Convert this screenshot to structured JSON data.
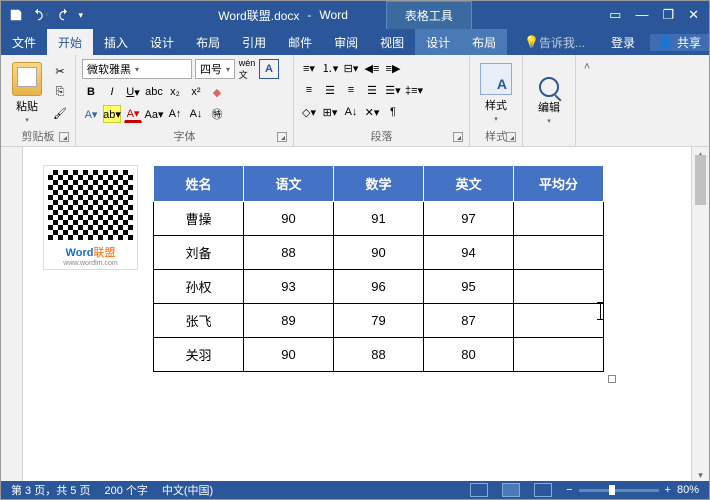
{
  "title": {
    "filename": "Word联盟.docx",
    "app": "Word",
    "tableTools": "表格工具"
  },
  "tabs": {
    "file": "文件",
    "home": "开始",
    "insert": "插入",
    "design": "设计",
    "layout": "布局",
    "references": "引用",
    "mail": "邮件",
    "review": "审阅",
    "view": "视图",
    "tdesign": "设计",
    "tlayout": "布局",
    "tell": "告诉我...",
    "login": "登录",
    "share": "共享"
  },
  "ribbon": {
    "clipboard": {
      "label": "剪贴板",
      "paste": "粘贴"
    },
    "font": {
      "label": "字体",
      "name": "微软雅黑",
      "size": "四号"
    },
    "paragraph": {
      "label": "段落"
    },
    "styles": {
      "label": "样式",
      "btn": "样式"
    },
    "editing": {
      "label": "编辑",
      "btn": "编辑"
    }
  },
  "qr": {
    "brand": "Word",
    "brand2": "联盟",
    "url": "www.wordlm.com"
  },
  "table": {
    "headers": [
      "姓名",
      "语文",
      "数学",
      "英文",
      "平均分"
    ],
    "rows": [
      {
        "name": "曹操",
        "c1": "90",
        "c2": "91",
        "c3": "97",
        "avg": ""
      },
      {
        "name": "刘备",
        "c1": "88",
        "c2": "90",
        "c3": "94",
        "avg": ""
      },
      {
        "name": "孙权",
        "c1": "93",
        "c2": "96",
        "c3": "95",
        "avg": ""
      },
      {
        "name": "张飞",
        "c1": "89",
        "c2": "79",
        "c3": "87",
        "avg": ""
      },
      {
        "name": "关羽",
        "c1": "90",
        "c2": "88",
        "c3": "80",
        "avg": ""
      }
    ]
  },
  "status": {
    "page": "第 3 页，共 5 页",
    "words": "200 个字",
    "lang": "中文(中国)",
    "zoom": "80%"
  }
}
